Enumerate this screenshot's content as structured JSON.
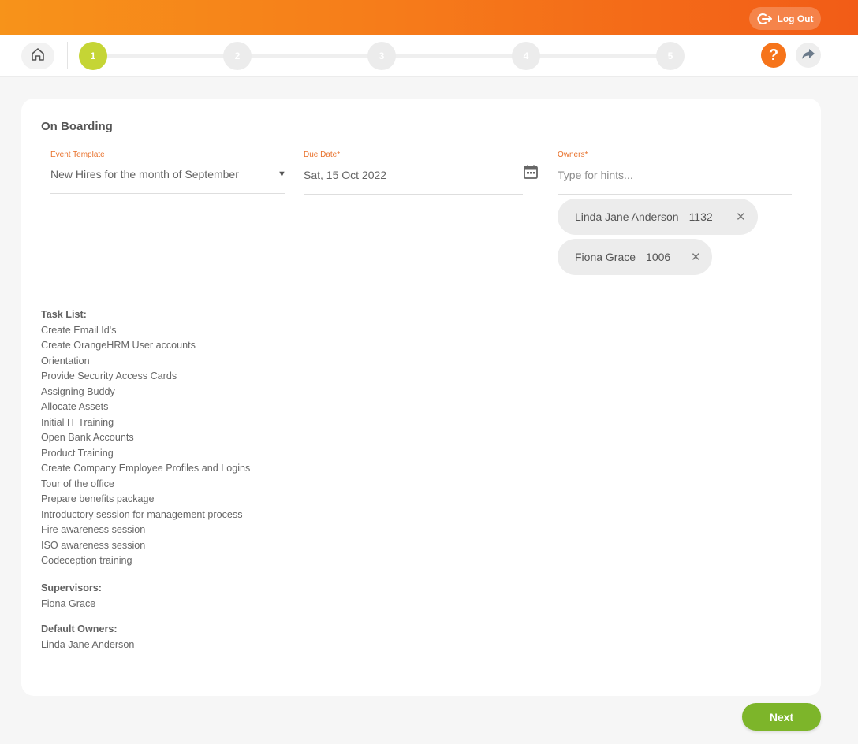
{
  "header": {
    "logout_label": "Log Out",
    "logout_icon": "logout-icon",
    "brand_gradient": [
      "#f7931a",
      "#f25c17"
    ]
  },
  "stepper": {
    "home_icon": "home-icon",
    "steps": [
      "1",
      "2",
      "3",
      "4",
      "5"
    ],
    "active_step": "1",
    "active_color": "#c5d535",
    "help_label": "?",
    "share_icon": "share-icon"
  },
  "form": {
    "title": "On Boarding",
    "event_template": {
      "label": "Event Template",
      "value": "New Hires for the month of September"
    },
    "due_date": {
      "label": "Due Date",
      "required_mark": "*",
      "value": "Sat, 15 Oct 2022",
      "icon": "calendar-icon"
    },
    "owners": {
      "label": "Owners",
      "required_mark": "*",
      "placeholder": "Type for hints...",
      "chips": [
        {
          "name": "Linda Jane Anderson",
          "id": "1132"
        },
        {
          "name": "Fiona Grace",
          "id": "1006"
        }
      ]
    }
  },
  "task_list": {
    "heading": "Task List:",
    "items": [
      "Create Email Id's",
      "Create OrangeHRM User accounts",
      "Orientation",
      "Provide Security Access Cards",
      "Assigning Buddy",
      "Allocate Assets",
      "Initial IT Training",
      "Open Bank Accounts",
      "Product Training",
      "Create Company Employee Profiles and Logins",
      "Tour of the office",
      "Prepare benefits package",
      "Introductory session for management process",
      "Fire awareness session",
      "ISO awareness session",
      "Codeception training"
    ]
  },
  "supervisors": {
    "heading": "Supervisors:",
    "items": [
      "Fiona Grace"
    ]
  },
  "default_owners": {
    "heading": "Default Owners:",
    "items": [
      "Linda Jane Anderson"
    ]
  },
  "footer": {
    "next_label": "Next",
    "next_color": "#7db52a"
  }
}
